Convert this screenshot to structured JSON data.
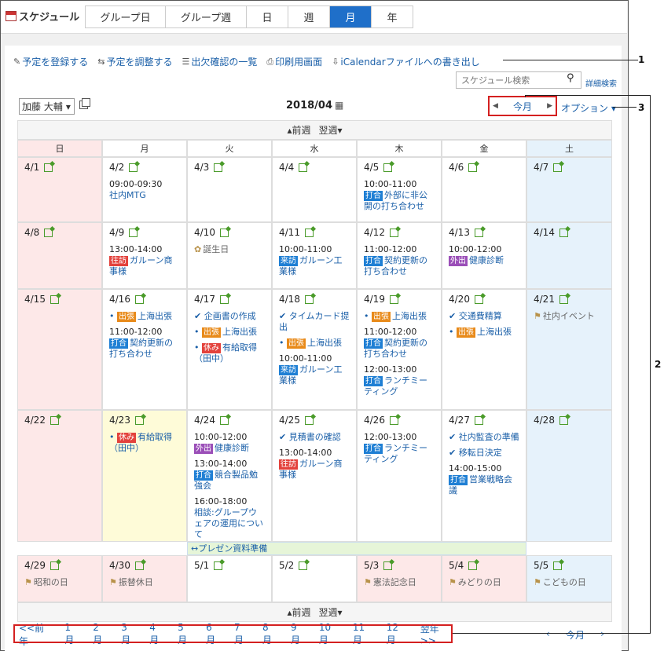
{
  "app": {
    "title": "スケジュール"
  },
  "tabs": [
    {
      "label": "グループ日",
      "active": false
    },
    {
      "label": "グループ週",
      "active": false
    },
    {
      "label": "日",
      "active": false
    },
    {
      "label": "週",
      "active": false
    },
    {
      "label": "月",
      "active": true
    },
    {
      "label": "年",
      "active": false
    }
  ],
  "actions": {
    "register": "予定を登録する",
    "adjust": "予定を調整する",
    "attendance": "出欠確認の一覧",
    "print": "印刷用画面",
    "ical": "iCalendarファイルへの書き出し"
  },
  "search": {
    "placeholder": "スケジュール検索",
    "advanced": "詳細検索"
  },
  "user": {
    "name": "加藤 大輔"
  },
  "month": {
    "label": "2018/04"
  },
  "nav": {
    "this_month": "今月",
    "option": "オプション"
  },
  "week_nav": {
    "prev": "前週",
    "next": "翌週"
  },
  "weekdays": [
    "日",
    "月",
    "火",
    "水",
    "木",
    "金",
    "土"
  ],
  "weeks": [
    [
      {
        "d": "4/1"
      },
      {
        "d": "4/2",
        "ev": [
          {
            "t": "09:00-09:30",
            "s": "社内MTG"
          }
        ]
      },
      {
        "d": "4/3"
      },
      {
        "d": "4/4"
      },
      {
        "d": "4/5",
        "ev": [
          {
            "t": "10:00-11:00",
            "b": "打合",
            "s": "外部に非公開の打ち合わせ"
          }
        ]
      },
      {
        "d": "4/6"
      },
      {
        "d": "4/7"
      }
    ],
    [
      {
        "d": "4/8"
      },
      {
        "d": "4/9",
        "ev": [
          {
            "t": "13:00-14:00",
            "b": "往訪",
            "s": "ガルーン商事様"
          }
        ]
      },
      {
        "d": "4/10",
        "ev": [
          {
            "s": "誕生日"
          }
        ]
      },
      {
        "d": "4/11",
        "ev": [
          {
            "t": "10:00-11:00",
            "b": "来訪",
            "s": "ガルーン工業様"
          }
        ]
      },
      {
        "d": "4/12",
        "ev": [
          {
            "t": "11:00-12:00",
            "b": "打合",
            "s": "契約更新の打ち合わせ"
          }
        ]
      },
      {
        "d": "4/13",
        "ev": [
          {
            "t": "10:00-12:00",
            "b": "外出",
            "s": "健康診断"
          }
        ]
      },
      {
        "d": "4/14"
      }
    ],
    [
      {
        "d": "4/15"
      },
      {
        "d": "4/16",
        "ev": [
          {
            "b": "出張",
            "s": "上海出張"
          },
          {
            "t": "11:00-12:00",
            "b": "打合",
            "s": "契約更新の打ち合わせ"
          }
        ]
      },
      {
        "d": "4/17",
        "ev": [
          {
            "s": "企画書の作成"
          },
          {
            "b": "出張",
            "s": "上海出張"
          },
          {
            "b": "休み",
            "s": "有給取得（田中）"
          }
        ]
      },
      {
        "d": "4/18",
        "ev": [
          {
            "s": "タイムカード提出"
          },
          {
            "b": "出張",
            "s": "上海出張"
          },
          {
            "t": "10:00-11:00",
            "b": "来訪",
            "s": "ガルーン工業様"
          }
        ]
      },
      {
        "d": "4/19",
        "ev": [
          {
            "b": "出張",
            "s": "上海出張"
          },
          {
            "t": "11:00-12:00",
            "b": "打合",
            "s": "契約更新の打ち合わせ"
          },
          {
            "t": "12:00-13:00",
            "b": "打合",
            "s": "ランチミーティング"
          }
        ]
      },
      {
        "d": "4/20",
        "ev": [
          {
            "s": "交通費精算"
          },
          {
            "b": "出張",
            "s": "上海出張"
          }
        ]
      },
      {
        "d": "4/21",
        "ev": [
          {
            "s": "社内イベント"
          }
        ]
      }
    ],
    [
      {
        "d": "4/22"
      },
      {
        "d": "4/23",
        "ev": [
          {
            "b": "休み",
            "s": "有給取得（田中）"
          }
        ]
      },
      {
        "d": "4/24",
        "ev": [
          {
            "t": "10:00-12:00",
            "b": "外出",
            "s": "健康診断"
          },
          {
            "t": "13:00-14:00",
            "b": "打合",
            "s": "競合製品勉強会"
          },
          {
            "t": "16:00-18:00",
            "s": "相談:グループウェアの運用について"
          }
        ]
      },
      {
        "d": "4/25",
        "ev": [
          {
            "s": "見積書の確認"
          },
          {
            "t": "13:00-14:00",
            "b": "往訪",
            "s": "ガルーン商事様"
          }
        ]
      },
      {
        "d": "4/26",
        "ev": [
          {
            "t": "12:00-13:00",
            "b": "打合",
            "s": "ランチミーティング"
          }
        ]
      },
      {
        "d": "4/27",
        "ev": [
          {
            "s": "社内監査の準備"
          },
          {
            "s": "移転日決定"
          },
          {
            "t": "14:00-15:00",
            "b": "打合",
            "s": "営業戦略会議"
          }
        ]
      },
      {
        "d": "4/28"
      }
    ],
    [
      {
        "d": "4/29",
        "ev": [
          {
            "s": "昭和の日"
          }
        ]
      },
      {
        "d": "4/30",
        "ev": [
          {
            "s": "振替休日"
          }
        ]
      },
      {
        "d": "5/1"
      },
      {
        "d": "5/2"
      },
      {
        "d": "5/3",
        "ev": [
          {
            "s": "憲法記念日"
          }
        ]
      },
      {
        "d": "5/4",
        "ev": [
          {
            "s": "みどりの日"
          }
        ]
      },
      {
        "d": "5/5",
        "ev": [
          {
            "s": "こどもの日"
          }
        ]
      }
    ]
  ],
  "banner": "プレゼン資料準備",
  "month_links": [
    "<<前年",
    "1月",
    "2月",
    "3月",
    "4月",
    "5月",
    "6月",
    "7月",
    "8月",
    "9月",
    "10月",
    "11月",
    "12月",
    "翌年>>"
  ],
  "callouts": [
    "1",
    "2",
    "3"
  ]
}
